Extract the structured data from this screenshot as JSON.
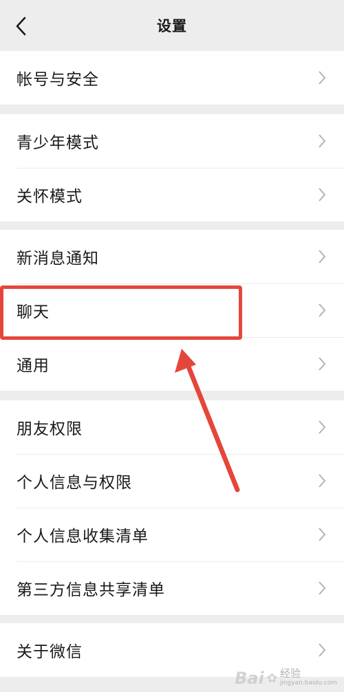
{
  "header": {
    "title": "设置"
  },
  "groups": [
    {
      "items": [
        {
          "label": "帐号与安全"
        }
      ]
    },
    {
      "items": [
        {
          "label": "青少年模式"
        },
        {
          "label": "关怀模式"
        }
      ]
    },
    {
      "items": [
        {
          "label": "新消息通知"
        },
        {
          "label": "聊天"
        },
        {
          "label": "通用"
        }
      ]
    },
    {
      "items": [
        {
          "label": "朋友权限"
        },
        {
          "label": "个人信息与权限"
        },
        {
          "label": "个人信息收集清单"
        },
        {
          "label": "第三方信息共享清单"
        }
      ]
    },
    {
      "items": [
        {
          "label": "关于微信"
        }
      ]
    }
  ],
  "annotation": {
    "color": "#e5463c",
    "highlighted_item": "聊天"
  },
  "watermark": {
    "brand": "Bai",
    "text": "经验",
    "domain": "jingyan.baidu.com"
  }
}
